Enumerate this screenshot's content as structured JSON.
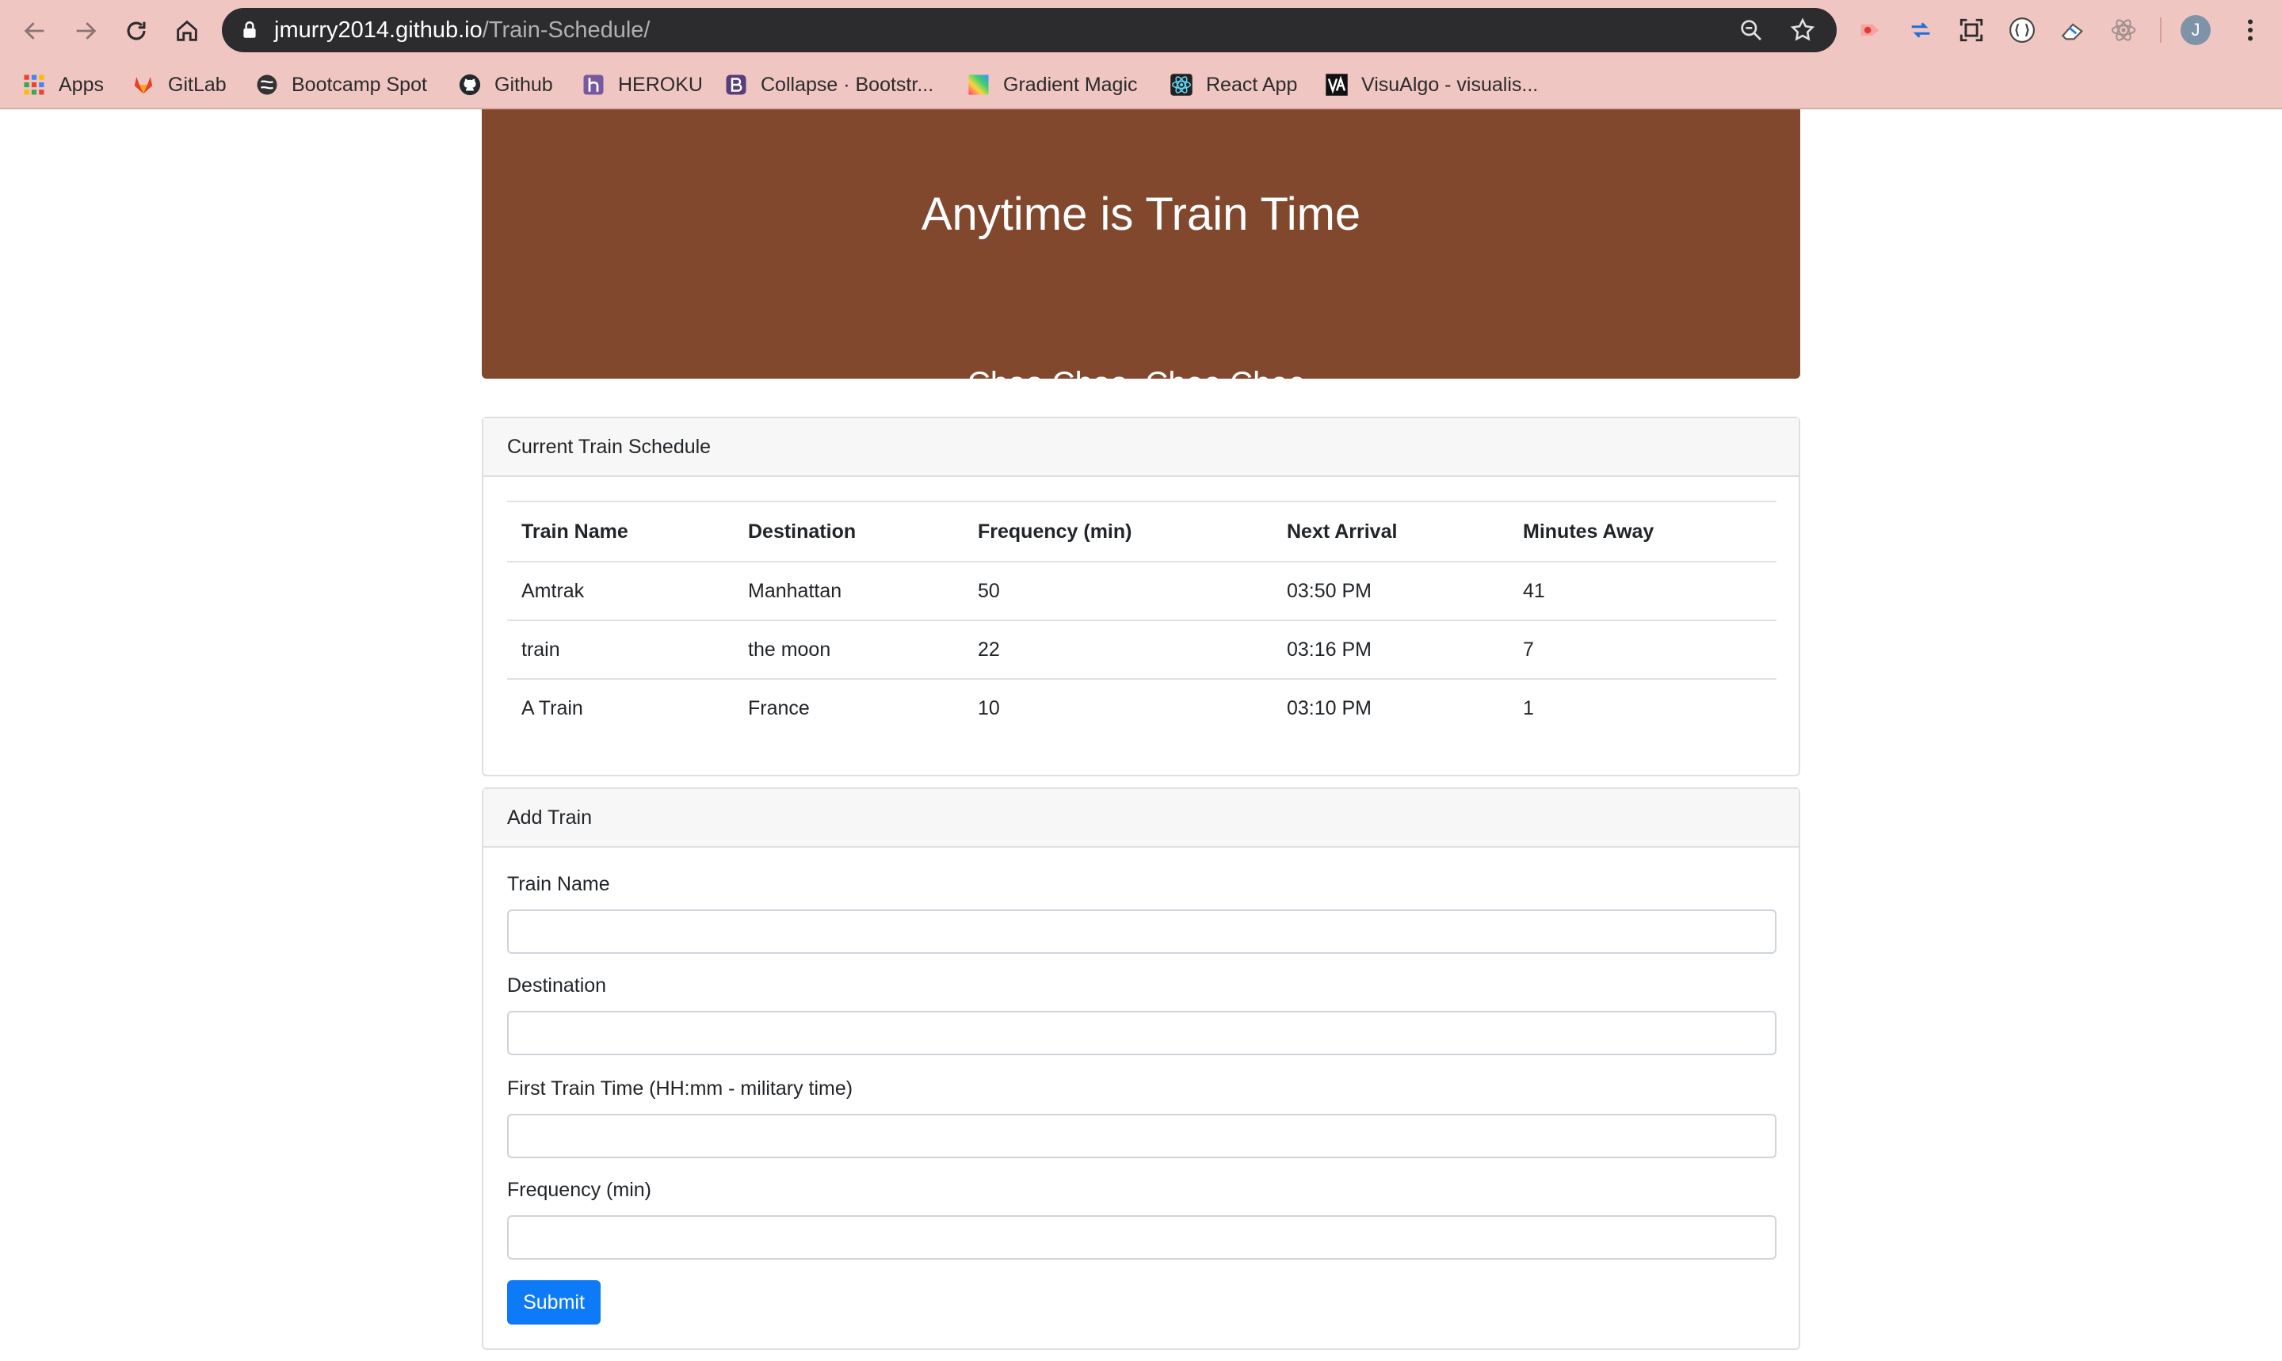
{
  "browser": {
    "url_host": "jmurry2014.github.io",
    "url_path": "/Train-Schedule/",
    "profile_initial": "J"
  },
  "bookmarks": [
    {
      "label": "Apps",
      "icon": "apps-grid-icon"
    },
    {
      "label": "GitLab",
      "icon": "gitlab-icon"
    },
    {
      "label": "Bootcamp Spot",
      "icon": "bootcamp-icon"
    },
    {
      "label": "Github",
      "icon": "github-icon"
    },
    {
      "label": "HEROKU",
      "icon": "heroku-icon"
    },
    {
      "label": "Collapse · Bootstr...",
      "icon": "bootstrap-icon"
    },
    {
      "label": "Gradient Magic",
      "icon": "gradient-icon"
    },
    {
      "label": "React App",
      "icon": "react-icon"
    },
    {
      "label": "VisuAlgo - visualis...",
      "icon": "visualgo-icon"
    }
  ],
  "jumbotron": {
    "title": "Anytime is Train Time",
    "subtitle": "Choo Choo. Chee Chee."
  },
  "schedule": {
    "header": "Current Train Schedule",
    "columns": [
      "Train Name",
      "Destination",
      "Frequency (min)",
      "Next Arrival",
      "Minutes Away"
    ],
    "rows": [
      [
        "Amtrak",
        "Manhattan",
        "50",
        "03:50 PM",
        "41"
      ],
      [
        "train",
        "the moon",
        "22",
        "03:16 PM",
        "7"
      ],
      [
        "A Train",
        "France",
        "10",
        "03:10 PM",
        "1"
      ]
    ]
  },
  "form": {
    "header": "Add Train",
    "fields": [
      {
        "label": "Train Name",
        "value": ""
      },
      {
        "label": "Destination",
        "value": ""
      },
      {
        "label": "First Train Time (HH:mm - military time)",
        "value": ""
      },
      {
        "label": "Frequency (min)",
        "value": ""
      }
    ],
    "submit_label": "Submit"
  },
  "colors": {
    "chrome": "#f0c6c2",
    "jumbotron": "#81482e",
    "primary_button": "#0d7bf7"
  }
}
